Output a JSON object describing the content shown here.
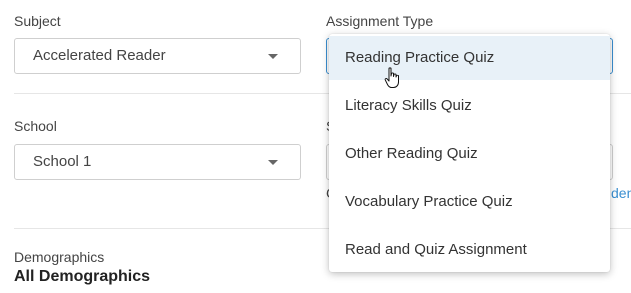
{
  "subject": {
    "label": "Subject",
    "value": "Accelerated Reader"
  },
  "assignment_type": {
    "label": "Assignment Type",
    "options": [
      "Reading Practice Quiz",
      "Literacy Skills Quiz",
      "Other Reading Quiz",
      "Vocabulary Practice Quiz",
      "Read and Quiz Assignment"
    ],
    "hovered_index": 0
  },
  "school": {
    "label": "School",
    "value": "School 1"
  },
  "partial": {
    "right_label_initial": "S",
    "right_hint_initial": "C",
    "right_link_fragment": "den"
  },
  "demographics": {
    "label": "Demographics",
    "value": "All Demographics"
  },
  "colors": {
    "link": "#3a8fd1",
    "hover": "#e8f1f8",
    "focus": "#3a8fd1"
  },
  "icons": [
    "chevron-down-icon",
    "hand-pointer-icon"
  ]
}
